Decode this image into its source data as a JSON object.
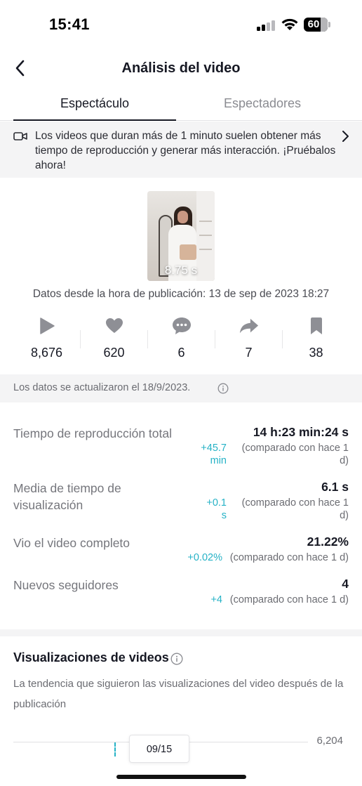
{
  "status_bar": {
    "time": "15:41",
    "battery": "60"
  },
  "header": {
    "title": "Análisis del video",
    "back_icon": "chevron-left-icon"
  },
  "tabs": [
    {
      "label": "Espectáculo",
      "active": true
    },
    {
      "label": "Espectadores",
      "active": false
    }
  ],
  "banner": {
    "icon": "video-camera-icon",
    "text": "Los videos que duran más de 1 minuto suelen obtener más tiempo de reproducción y generar más interacción. ¡Pruébalos ahora!"
  },
  "video": {
    "duration": "8.75 s",
    "since_text": "Datos desde la hora de publicación: 13 de sep de 2023 18:27"
  },
  "engagement": [
    {
      "icon": "play-icon",
      "value": "8,676"
    },
    {
      "icon": "heart-icon",
      "value": "620"
    },
    {
      "icon": "comment-icon",
      "value": "6"
    },
    {
      "icon": "share-icon",
      "value": "7"
    },
    {
      "icon": "bookmark-icon",
      "value": "38"
    }
  ],
  "updated_text": "Los datos se actualizaron el 18/9/2023.",
  "metrics": [
    {
      "label": "Tiempo de reproducción total",
      "value": "14 h:23 min:24 s",
      "delta_line1": "+45.7",
      "delta_line2": "min",
      "compare_line1": "(comparado con hace 1",
      "compare_line2": "d)"
    },
    {
      "label": "Media de tiempo de visualización",
      "value": "6.1 s",
      "delta_line1": "+0.1",
      "delta_line2": "s",
      "compare_line1": "(comparado con hace 1",
      "compare_line2": "d)"
    },
    {
      "label": "Vio el video completo",
      "value": "21.22%",
      "delta": "+0.02%",
      "compare": "(comparado con hace 1 d)"
    },
    {
      "label": "Nuevos seguidores",
      "value": "4",
      "delta": "+4",
      "compare": "(comparado con hace 1 d)"
    }
  ],
  "video_views": {
    "title": "Visualizaciones de videos",
    "description": "La tendencia que siguieron las visualizaciones del video después de la publicación"
  },
  "chart_data": {
    "type": "line",
    "y_max_label": "6,204",
    "tooltip_date": "09/15"
  },
  "colors": {
    "accent": "#25b2c6",
    "text": "#161823",
    "muted": "#75767c"
  }
}
